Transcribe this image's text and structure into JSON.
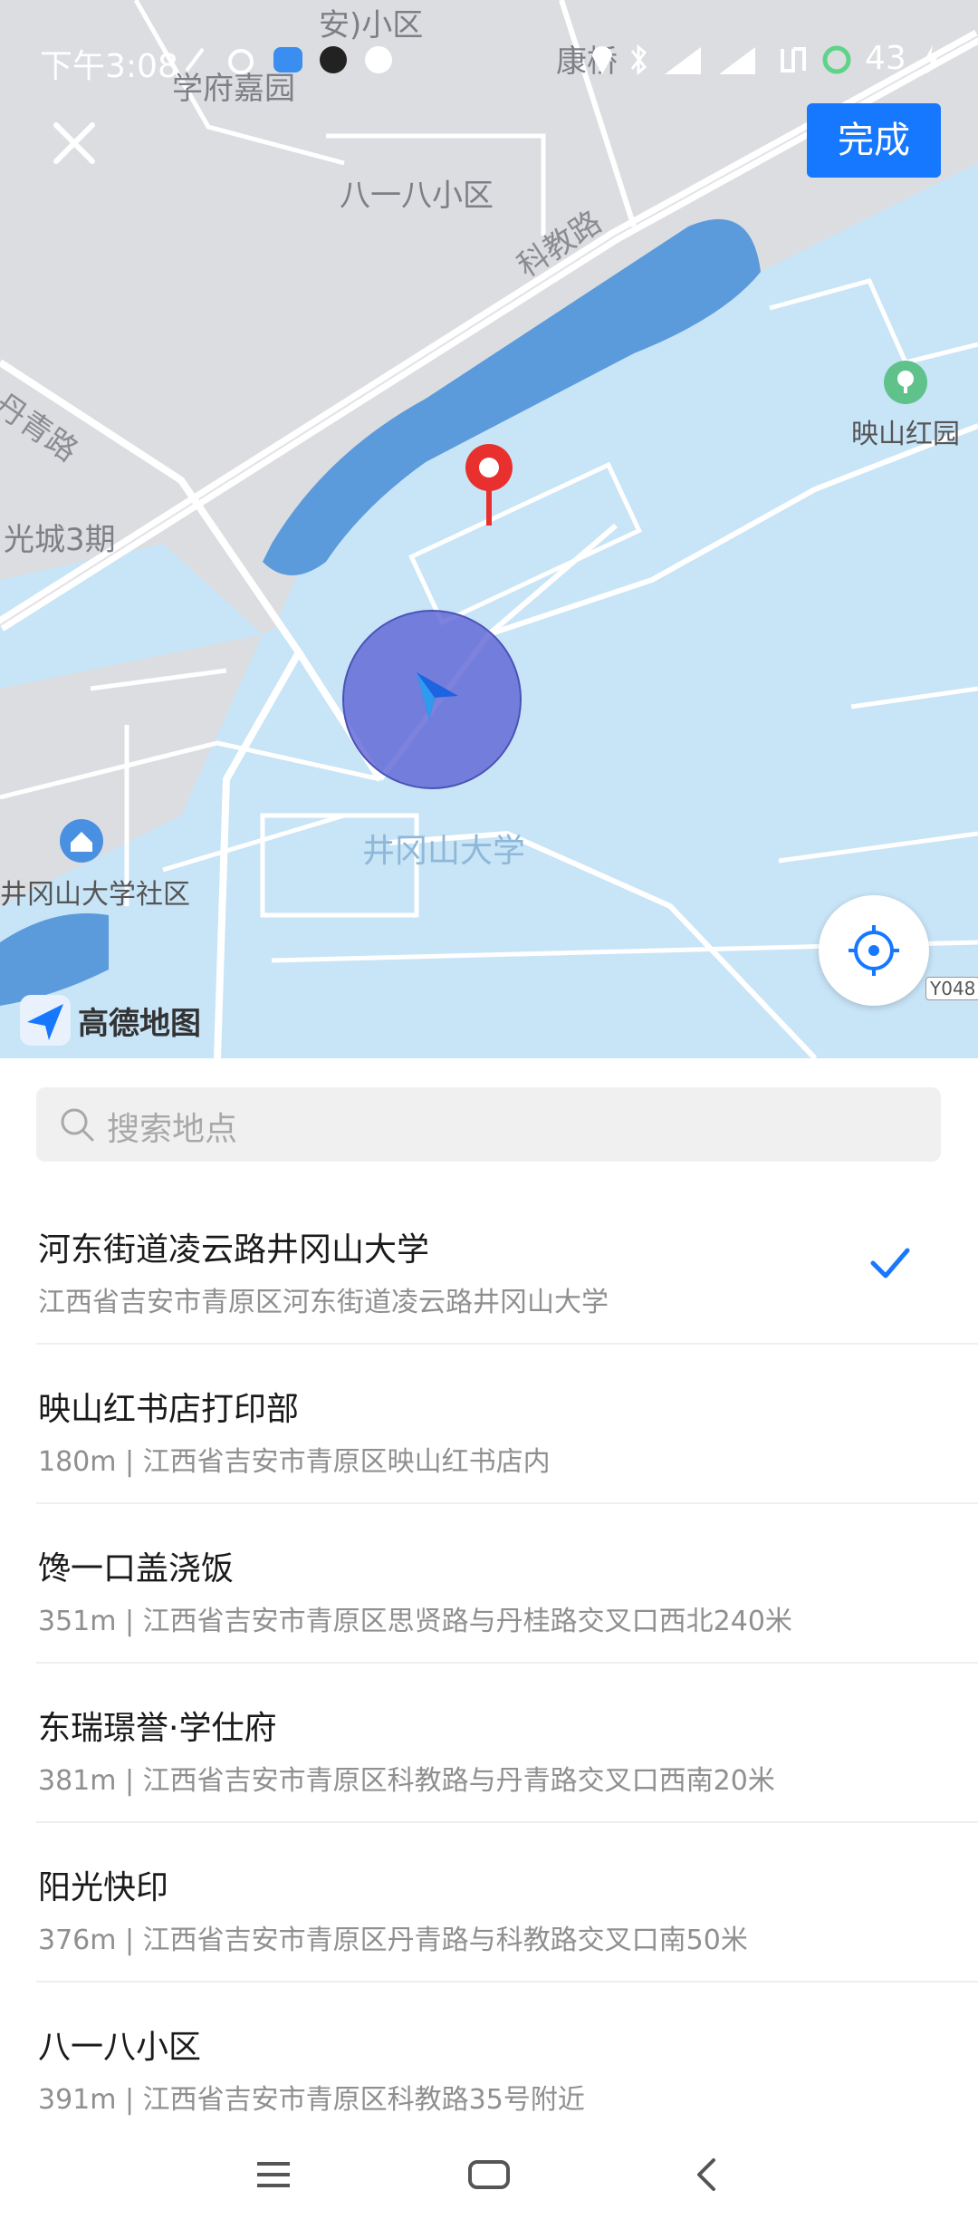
{
  "status_bar": {
    "time": "下午3:08",
    "battery": "43"
  },
  "header": {
    "done_label": "完成"
  },
  "map": {
    "labels": {
      "top_area": "安)小区",
      "kang": "康桥",
      "xuefu": "学府嘉园",
      "bayiba": "八一八小区",
      "kejiao_road": "科教路",
      "danqing_road": "丹青路",
      "guangcheng": "光城3期",
      "yingshan_park": "映山红园",
      "university": "井冈山大学",
      "university_community": "井冈山大学社区",
      "road_code": "Y048"
    },
    "brand": "高德地图"
  },
  "search": {
    "placeholder": "搜索地点"
  },
  "results": [
    {
      "title": "河东街道凌云路井冈山大学",
      "subtitle": "江西省吉安市青原区河东街道凌云路井冈山大学",
      "selected": true
    },
    {
      "title": "映山红书店打印部",
      "subtitle": "180m | 江西省吉安市青原区映山红书店内",
      "selected": false
    },
    {
      "title": "馋一口盖浇饭",
      "subtitle": "351m | 江西省吉安市青原区思贤路与丹桂路交叉口西北240米",
      "selected": false
    },
    {
      "title": "东瑞璟誉·学仕府",
      "subtitle": "381m | 江西省吉安市青原区科教路与丹青路交叉口西南20米",
      "selected": false
    },
    {
      "title": "阳光快印",
      "subtitle": "376m | 江西省吉安市青原区丹青路与科教路交叉口南50米",
      "selected": false
    },
    {
      "title": "八一八小区",
      "subtitle": "391m | 江西省吉安市青原区科教路35号附近",
      "selected": false
    }
  ],
  "colors": {
    "accent": "#1677ff",
    "campus": "#c8e4f7",
    "water": "#5b9bdc",
    "pin": "#e8302f"
  },
  "icons": {
    "close": "close-icon",
    "locate": "locate-icon",
    "search": "search-icon",
    "check": "check-icon"
  }
}
